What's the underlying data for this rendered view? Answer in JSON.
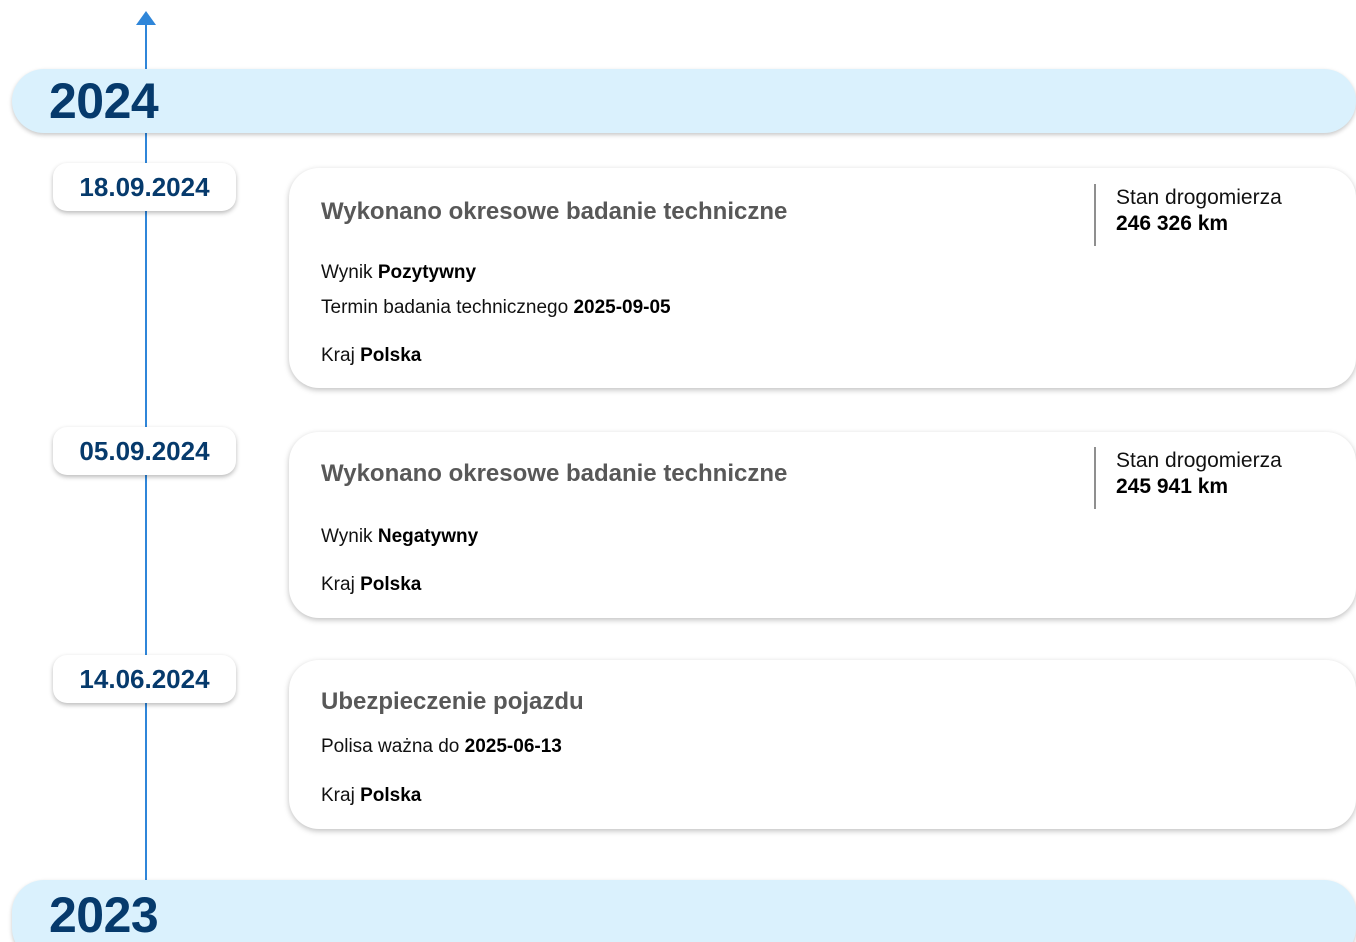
{
  "timeline": {
    "years": [
      {
        "label": "2024"
      },
      {
        "label": "2023"
      }
    ],
    "events": [
      {
        "date": "18.09.2024",
        "title": "Wykonano okresowe badanie techniczne",
        "odometer": {
          "label": "Stan drogomierza",
          "value": "246 326 km"
        },
        "rows": [
          {
            "label": "Wynik",
            "value": "Pozytywny"
          },
          {
            "label": "Termin badania technicznego",
            "value": "2025-09-05"
          },
          {
            "label": "Kraj",
            "value": "Polska"
          }
        ]
      },
      {
        "date": "05.09.2024",
        "title": "Wykonano okresowe badanie techniczne",
        "odometer": {
          "label": "Stan drogomierza",
          "value": "245 941 km"
        },
        "rows": [
          {
            "label": "Wynik",
            "value": "Negatywny"
          },
          {
            "label": "Kraj",
            "value": "Polska"
          }
        ]
      },
      {
        "date": "14.06.2024",
        "title": "Ubezpieczenie pojazdu",
        "rows": [
          {
            "label": "Polisa ważna do",
            "value": "2025-06-13"
          },
          {
            "label": "Kraj",
            "value": "Polska"
          }
        ]
      }
    ]
  },
  "colors": {
    "timeline_line": "#2f86d9",
    "year_banner_bg": "#daf1fd",
    "year_text": "#063a6c",
    "card_title": "#585858"
  }
}
